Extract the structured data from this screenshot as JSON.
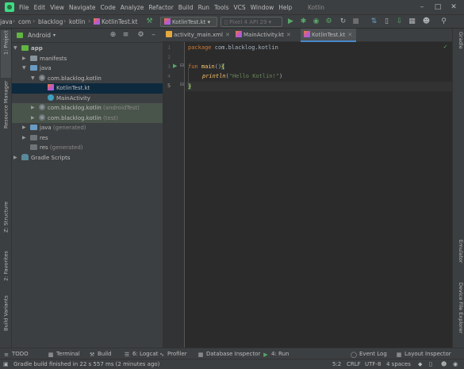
{
  "window": {
    "title": "Kotlin"
  },
  "menu": [
    "File",
    "Edit",
    "View",
    "Navigate",
    "Code",
    "Analyze",
    "Refactor",
    "Build",
    "Run",
    "Tools",
    "VCS",
    "Window",
    "Help"
  ],
  "breadcrumbs": [
    "java",
    "com",
    "blacklog",
    "kotlin",
    "KotlinTest.kt"
  ],
  "toolbar": {
    "run_config": "KotlinTest.kt",
    "device": "Pixel 4 API 29"
  },
  "project_panel": {
    "view": "Android",
    "tree": [
      {
        "label": "app",
        "suffix": ""
      },
      {
        "label": "manifests",
        "suffix": ""
      },
      {
        "label": "java",
        "suffix": ""
      },
      {
        "label": "com.blacklog.kotlin",
        "suffix": ""
      },
      {
        "label": "KotlinTest.kt",
        "suffix": ""
      },
      {
        "label": "MainActivity",
        "suffix": ""
      },
      {
        "label": "com.blacklog.kotlin",
        "suffix": "(androidTest)"
      },
      {
        "label": "com.blacklog.kotlin",
        "suffix": "(test)"
      },
      {
        "label": "java",
        "suffix": "(generated)"
      },
      {
        "label": "res",
        "suffix": ""
      },
      {
        "label": "res",
        "suffix": "(generated)"
      },
      {
        "label": "Gradle Scripts",
        "suffix": ""
      }
    ]
  },
  "left_tabs": {
    "project": "1: Project",
    "resource_manager": "Resource Manager",
    "structure": "Z: Structure",
    "favorites": "2: Favorites",
    "build_variants": "Build Variants"
  },
  "right_tabs": {
    "gradle": "Gradle",
    "emulator": "Emulator",
    "device_file_explorer": "Device File Explorer"
  },
  "editor_tabs": [
    {
      "label": "activity_main.xml",
      "active": false
    },
    {
      "label": "MainActivity.kt",
      "active": false
    },
    {
      "label": "KotlinTest.kt",
      "active": true
    }
  ],
  "editor": {
    "line_numbers": [
      "1",
      "2",
      "3",
      "4",
      "5"
    ],
    "code": {
      "l1_kw": "package",
      "l1_rest": " com.blacklog.kotlin",
      "l3_kw": "fun",
      "l3_name": "main",
      "l3_paren": "()",
      "l3_brace": "{",
      "l4_call": "println",
      "l4_open": "(",
      "l4_str": "\"Hello Kotlin!\"",
      "l4_close": ")",
      "l5_brace": "}"
    }
  },
  "bottom_tools": {
    "todo": "TODO",
    "terminal": "Terminal",
    "build": "Build",
    "logcat": "6: Logcat",
    "profiler": "Profiler",
    "database_inspector": "Database Inspector",
    "run": "4: Run",
    "event_log": "Event Log",
    "layout_inspector": "Layout Inspector"
  },
  "status": {
    "message": "Gradle build finished in 22 s 557 ms (2 minutes ago)",
    "position": "5:2",
    "line_sep": "CRLF",
    "encoding": "UTF-8",
    "indent": "4 spaces"
  },
  "colors": {
    "accent": "#4a88c7",
    "run_green": "#59a869",
    "selection": "#0d293e"
  }
}
